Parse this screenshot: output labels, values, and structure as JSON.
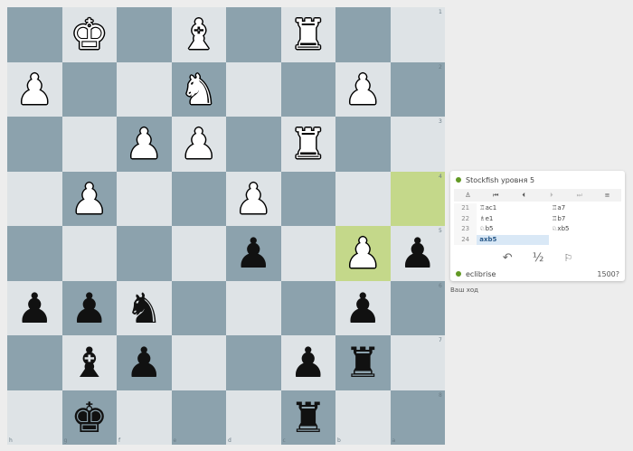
{
  "board": {
    "orientation": "black",
    "highlight_squares": [
      "a4",
      "b5"
    ],
    "rank_labels": [
      "1",
      "2",
      "3",
      "4",
      "5",
      "6",
      "7",
      "8"
    ],
    "file_labels": [
      "h",
      "g",
      "f",
      "e",
      "d",
      "c",
      "b",
      "a"
    ],
    "pieces": [
      {
        "square": "g1",
        "piece": "K",
        "color": "white",
        "glyph": "♚"
      },
      {
        "square": "e1",
        "piece": "B",
        "color": "white",
        "glyph": "♝"
      },
      {
        "square": "c1",
        "piece": "R",
        "color": "white",
        "glyph": "♜"
      },
      {
        "square": "h2",
        "piece": "P",
        "color": "white",
        "glyph": "♟"
      },
      {
        "square": "e2",
        "piece": "N",
        "color": "white",
        "glyph": "♞"
      },
      {
        "square": "b2",
        "piece": "P",
        "color": "white",
        "glyph": "♟"
      },
      {
        "square": "f3",
        "piece": "P",
        "color": "white",
        "glyph": "♟"
      },
      {
        "square": "e3",
        "piece": "P",
        "color": "white",
        "glyph": "♟"
      },
      {
        "square": "c3",
        "piece": "R",
        "color": "white",
        "glyph": "♜"
      },
      {
        "square": "g4",
        "piece": "P",
        "color": "white",
        "glyph": "♟"
      },
      {
        "square": "d4",
        "piece": "P",
        "color": "white",
        "glyph": "♟"
      },
      {
        "square": "d5",
        "piece": "P",
        "color": "black",
        "glyph": "♟"
      },
      {
        "square": "b5",
        "piece": "P",
        "color": "white",
        "glyph": "♟"
      },
      {
        "square": "a5",
        "piece": "P",
        "color": "black",
        "glyph": "♟"
      },
      {
        "square": "h6",
        "piece": "P",
        "color": "black",
        "glyph": "♟"
      },
      {
        "square": "g6",
        "piece": "P",
        "color": "black",
        "glyph": "♟"
      },
      {
        "square": "f6",
        "piece": "N",
        "color": "black",
        "glyph": "♞"
      },
      {
        "square": "b6",
        "piece": "P",
        "color": "black",
        "glyph": "♟"
      },
      {
        "square": "g7",
        "piece": "B",
        "color": "black",
        "glyph": "♝"
      },
      {
        "square": "f7",
        "piece": "P",
        "color": "black",
        "glyph": "♟"
      },
      {
        "square": "c7",
        "piece": "P",
        "color": "black",
        "glyph": "♟"
      },
      {
        "square": "b7",
        "piece": "R",
        "color": "black",
        "glyph": "♜"
      },
      {
        "square": "g8",
        "piece": "K",
        "color": "black",
        "glyph": "♚"
      },
      {
        "square": "c8",
        "piece": "R",
        "color": "black",
        "glyph": "♜"
      }
    ]
  },
  "opponent": {
    "name": "Stockfish уровня 5"
  },
  "player": {
    "name": "eclibrise",
    "rating": "1500?"
  },
  "controls": [
    {
      "name": "engine-icon",
      "glyph": "♙"
    },
    {
      "name": "first-move-icon",
      "glyph": "⏮"
    },
    {
      "name": "prev-move-icon",
      "glyph": "⏴"
    },
    {
      "name": "next-move-icon",
      "glyph": "⏵"
    },
    {
      "name": "last-move-icon",
      "glyph": "⏭"
    },
    {
      "name": "menu-icon",
      "glyph": "≡"
    }
  ],
  "moves": [
    {
      "num": "21",
      "white": "♖ac1",
      "black": "♖a7"
    },
    {
      "num": "22",
      "white": "♗e1",
      "black": "♖b7"
    },
    {
      "num": "23",
      "white": "♘b5",
      "black": "♘xb5"
    },
    {
      "num": "24",
      "white": "axb5",
      "black": ""
    }
  ],
  "actions": {
    "takeback": "↶",
    "draw": "½",
    "resign": "⚐"
  },
  "status_text": "Ваш ход"
}
